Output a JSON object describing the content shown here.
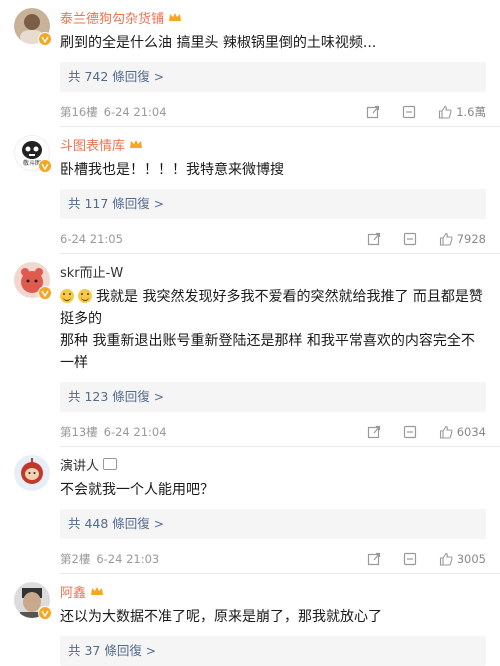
{
  "comments": [
    {
      "name": "泰兰德狗勾杂货铺",
      "name_color": "orange",
      "text": "刷到的全是什么油 搞里头 辣椒锅里倒的土味视频...",
      "replies": "共 742 條回復",
      "floor": "第16樓",
      "time": "6-24 21:04",
      "likes": "1.6萬"
    },
    {
      "name": "斗图表情库",
      "name_color": "orange",
      "avatar_text": "敬斗图",
      "text": "卧槽我也是！！！！我特意来微博搜",
      "replies": "共 117 條回復",
      "floor": "",
      "time": "6-24 21:05",
      "likes": "7928"
    },
    {
      "name": "skr而止-W",
      "name_color": "gray",
      "text_line1": "我就是 我突然发现好多我不爱看的突然就给我推了 而且都是赞挺多的",
      "text_line2": "那种 我重新退出账号重新登陆还是那样 和我平常喜欢的内容完全不一样",
      "replies": "共 123 條回復",
      "floor": "第13樓",
      "time": "6-24 21:04",
      "likes": "6034"
    },
    {
      "name": "演讲人",
      "name_color": "gray",
      "text": "不会就我一个人能用吧？",
      "replies": "共 448 條回復",
      "floor": "第2樓",
      "time": "6-24 21:03",
      "likes": "3005"
    },
    {
      "name": "阿鑫",
      "name_color": "orange",
      "text": "还以为大数据不准了呢，原来是崩了，那我就放心了",
      "replies": "共 37 條回復"
    }
  ],
  "reply_chevron": ">",
  "colors": {
    "accent_orange": "#eb7350",
    "link_blue": "#536b8c",
    "meta_gray": "#999999"
  }
}
